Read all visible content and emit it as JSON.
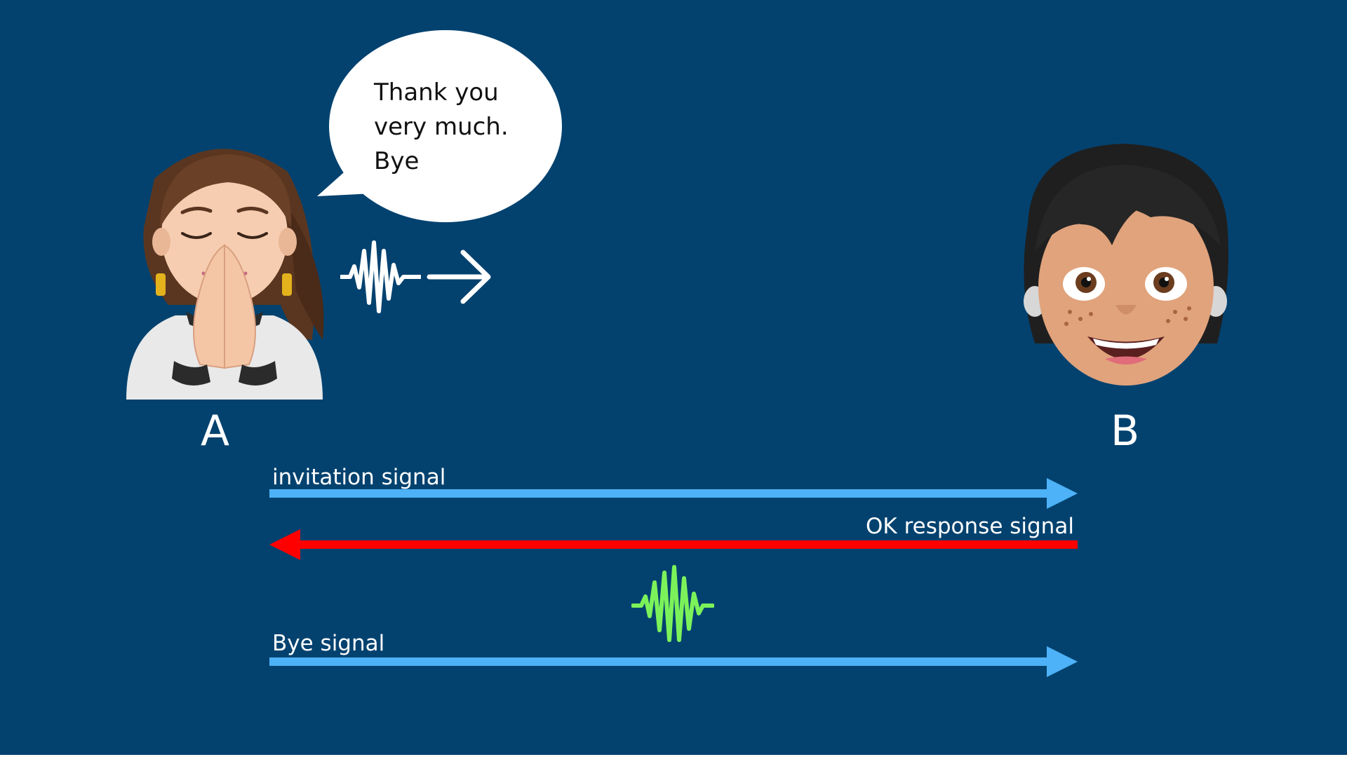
{
  "speech": {
    "text": "Thank you\nvery much.\nBye"
  },
  "parties": {
    "a_label": "A",
    "b_label": "B"
  },
  "signals": {
    "invitation_label": "invitation signal",
    "ok_label": "OK response signal",
    "bye_label": "Bye signal"
  },
  "icons": {
    "avatar_a": "woman-bowing-thanks-avatar",
    "avatar_b": "smiling-boy-avatar",
    "voice_wave": "sound-wave-icon",
    "voice_arrow": "right-arrow-icon",
    "media_wave": "sound-wave-icon"
  },
  "colors": {
    "background": "#03426f",
    "request_arrow": "#4db2f7",
    "response_arrow": "#ff0000",
    "media_wave": "#7cf25a",
    "speech_bubble": "#ffffff"
  }
}
